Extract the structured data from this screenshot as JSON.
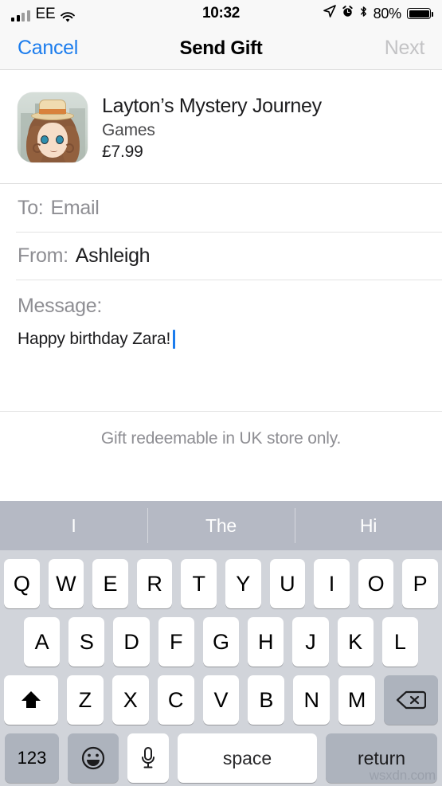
{
  "status_bar": {
    "carrier": "EE",
    "time": "10:32",
    "battery_percent": "80%",
    "icons": [
      "signal-bars-icon",
      "wifi-icon",
      "location-arrow-icon",
      "alarm-clock-icon",
      "bluetooth-icon",
      "battery-icon"
    ]
  },
  "nav_bar": {
    "cancel_label": "Cancel",
    "title": "Send Gift",
    "next_label": "Next",
    "cancel_color": "#1b7ced",
    "next_color": "#c3c3c5"
  },
  "app": {
    "icon_name": "layton-app-icon",
    "title": "Layton’s Mystery Journey",
    "category": "Games",
    "price": "£7.99"
  },
  "form": {
    "to": {
      "label": "To:",
      "placeholder": "Email",
      "value": ""
    },
    "from": {
      "label": "From:",
      "value": "Ashleigh"
    },
    "message": {
      "label": "Message:",
      "value": "Happy birthday Zara!"
    }
  },
  "footnote": "Gift redeemable in UK store only.",
  "keyboard": {
    "predictions": [
      "I",
      "The",
      "Hi"
    ],
    "row1": [
      "Q",
      "W",
      "E",
      "R",
      "T",
      "Y",
      "U",
      "I",
      "O",
      "P"
    ],
    "row2": [
      "A",
      "S",
      "D",
      "F",
      "G",
      "H",
      "J",
      "K",
      "L"
    ],
    "row3": [
      "Z",
      "X",
      "C",
      "V",
      "B",
      "N",
      "M"
    ],
    "shift_icon": "shift-arrow-icon",
    "backspace_icon": "backspace-delete-icon",
    "numbers_label": "123",
    "emoji_icon": "emoji-smiley-icon",
    "mic_icon": "microphone-icon",
    "space_label": "space",
    "return_label": "return",
    "background_color": "#d1d4da",
    "prediction_bar_color": "#b5b9c4",
    "key_color": "#ffffff",
    "modifier_key_color": "#adb3bd"
  },
  "watermark": "wsxdn.com"
}
